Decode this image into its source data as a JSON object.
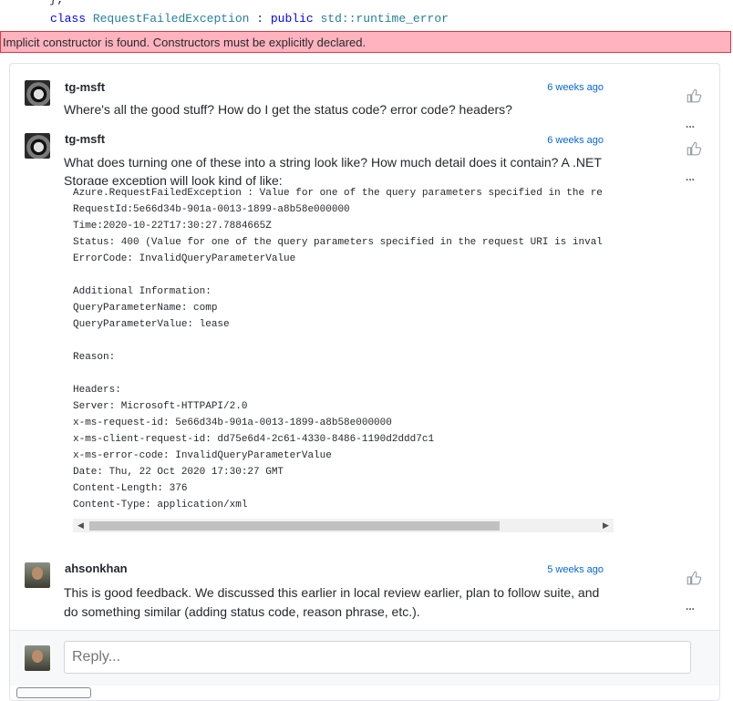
{
  "code_context": {
    "prev_line": "};",
    "kw_class": "class",
    "class_name": "RequestFailedException",
    "colon": " : ",
    "kw_public": "public",
    "base": "std::runtime_error"
  },
  "error_banner": "Implicit constructor is found. Constructors must be explicitly declared.",
  "comments": [
    {
      "author": "tg-msft",
      "time": "6 weeks ago",
      "body": "Where's all the good stuff? How do I get the status code? error code? headers?"
    },
    {
      "author": "tg-msft",
      "time": "6 weeks ago",
      "body_line1": "What does turning one of these into a string look like? How much detail does it contain? A .NET",
      "body_line2": "Storage exception will look kind of like:",
      "code": "Azure.RequestFailedException : Value for one of the query parameters specified in the re\nRequestId:5e66d34b-901a-0013-1899-a8b58e000000\nTime:2020-10-22T17:30:27.7884665Z\nStatus: 400 (Value for one of the query parameters specified in the request URI is inval\nErrorCode: InvalidQueryParameterValue\n\nAdditional Information:\nQueryParameterName: comp\nQueryParameterValue: lease\n\nReason:\n\nHeaders:\nServer: Microsoft-HTTPAPI/2.0\nx-ms-request-id: 5e66d34b-901a-0013-1899-a8b58e000000\nx-ms-client-request-id: dd75e6d4-2c61-4330-8486-1190d2ddd7c1\nx-ms-error-code: InvalidQueryParameterValue\nDate: Thu, 22 Oct 2020 17:30:27 GMT\nContent-Length: 376\nContent-Type: application/xml"
    },
    {
      "author": "ahsonkhan",
      "time": "5 weeks ago",
      "body_line1": "This is good feedback. We discussed this earlier in local review earlier, plan to follow suite, and",
      "body_line2": "do something similar (adding status code, reason phrase, etc.)."
    }
  ],
  "more_label": "...",
  "reply": {
    "placeholder": "Reply..."
  },
  "icons": {
    "like": "thumbs-up-icon",
    "more": "more-dots-icon",
    "avatar": "user-avatar"
  }
}
